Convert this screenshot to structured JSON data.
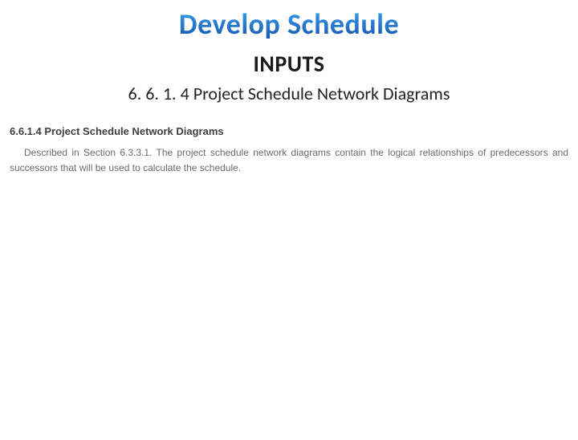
{
  "title": "Develop Schedule",
  "subheader": "INPUTS",
  "section_number": "6. 6. 1. 4 Project Schedule Network Diagrams",
  "excerpt": {
    "heading": "6.6.1.4 Project Schedule Network Diagrams",
    "body": "Described in Section 6.3.3.1. The project schedule network diagrams contain the logical relationships of predecessors and successors that will be used to calculate the schedule."
  }
}
